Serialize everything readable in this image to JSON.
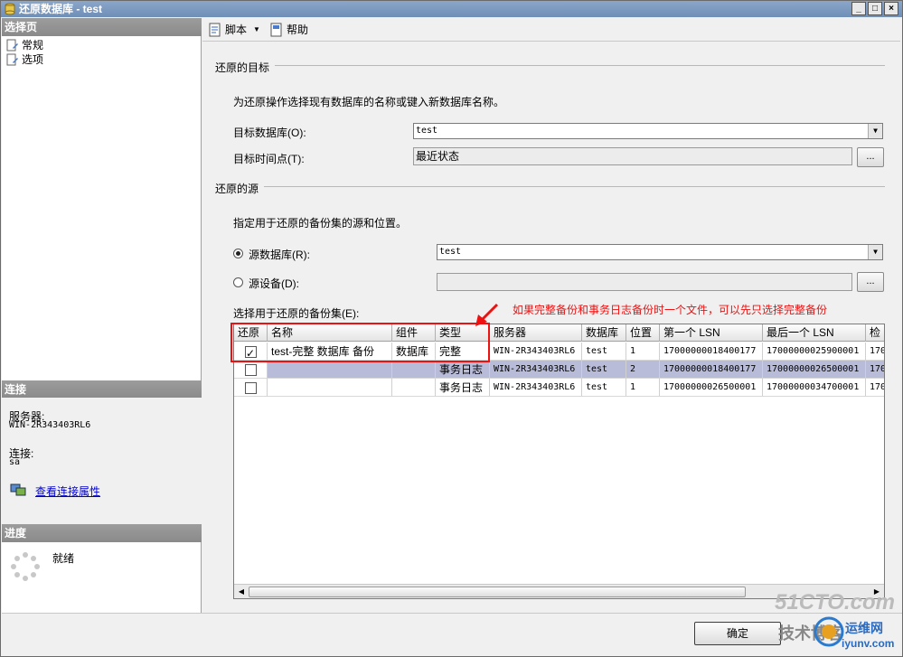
{
  "window": {
    "title": "还原数据库 - test",
    "btn_min": "_",
    "btn_max": "□",
    "btn_close": "×"
  },
  "left": {
    "select_page_header": "选择页",
    "pages": [
      "常规",
      "选项"
    ],
    "connection_header": "连接",
    "server_label": "服务器:",
    "server_value": "WIN-2R343403RL6",
    "connection_label": "连接:",
    "connection_value": "sa",
    "view_conn_props": "查看连接属性",
    "progress_header": "进度",
    "progress_status": "就绪"
  },
  "toolbar": {
    "script_label": "脚本",
    "help_label": "帮助"
  },
  "dest": {
    "group_title": "还原的目标",
    "description": "为还原操作选择现有数据库的名称或键入新数据库名称。",
    "target_db_label": "目标数据库(O):",
    "target_db_value": "test",
    "target_time_label": "目标时间点(T):",
    "target_time_value": "最近状态",
    "dots": "..."
  },
  "source": {
    "group_title": "还原的源",
    "description": "指定用于还原的备份集的源和位置。",
    "source_db_label": "源数据库(R):",
    "source_db_value": "test",
    "source_device_label": "源设备(D):",
    "dots": "...",
    "backup_sets_label": "选择用于还原的备份集(E):"
  },
  "grid": {
    "columns": [
      "还原",
      "名称",
      "组件",
      "类型",
      "服务器",
      "数据库",
      "位置",
      "第一个 LSN",
      "最后一个 LSN",
      "检"
    ],
    "rows": [
      {
        "checked": true,
        "name": "test-完整 数据库 备份",
        "component": "数据库",
        "type": "完整",
        "server": "WIN-2R343403RL6",
        "database": "test",
        "position": "1",
        "first_lsn": "17000000018400177",
        "last_lsn": "17000000025900001",
        "chk": "170"
      },
      {
        "checked": false,
        "name": "",
        "component": "",
        "type": "事务日志",
        "server": "WIN-2R343403RL6",
        "database": "test",
        "position": "2",
        "first_lsn": "17000000018400177",
        "last_lsn": "17000000026500001",
        "chk": "170"
      },
      {
        "checked": false,
        "name": "",
        "component": "",
        "type": "事务日志",
        "server": "WIN-2R343403RL6",
        "database": "test",
        "position": "1",
        "first_lsn": "17000000026500001",
        "last_lsn": "17000000034700001",
        "chk": "170"
      }
    ]
  },
  "annotation": {
    "text": "如果完整备份和事务日志备份时一个文件，可以先只选择完整备份",
    "color": "#e11111"
  },
  "footer": {
    "ok_label": "确定"
  },
  "watermark": {
    "site": "51CTO.com",
    "tag": "技术博客",
    "brand": "运维网",
    "url": "iyunv.com"
  }
}
